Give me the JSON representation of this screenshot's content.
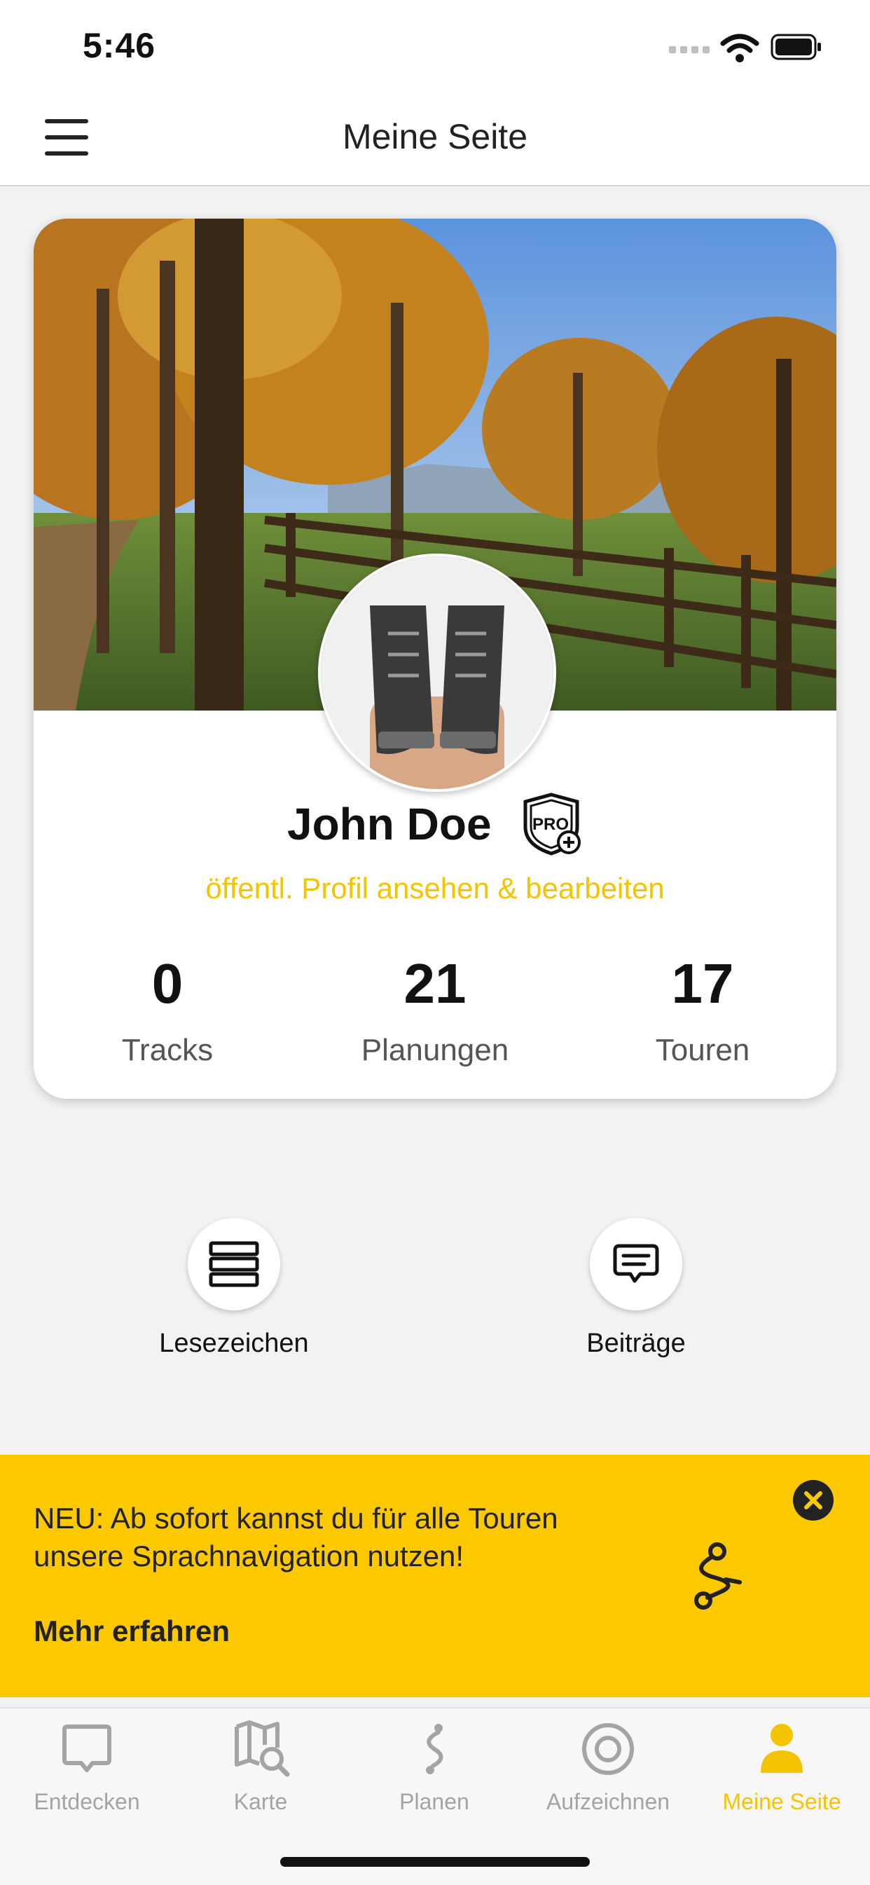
{
  "status_bar": {
    "time": "5:46"
  },
  "nav": {
    "title": "Meine Seite"
  },
  "profile": {
    "name": "John Doe",
    "link": "öffentl. Profil ansehen & bearbeiten",
    "badge_label": "PRO",
    "stats": [
      {
        "value": "0",
        "label": "Tracks"
      },
      {
        "value": "21",
        "label": "Planungen"
      },
      {
        "value": "17",
        "label": "Touren"
      }
    ]
  },
  "quick_actions": [
    {
      "label": "Lesezeichen",
      "icon": "bookmarks-icon"
    },
    {
      "label": "Beiträge",
      "icon": "posts-icon"
    }
  ],
  "banner": {
    "text": "NEU: Ab sofort kannst du für alle Touren unsere Sprachnavigation nutzen!",
    "link": "Mehr erfahren"
  },
  "tabs": [
    {
      "label": "Entdecken",
      "icon": "discover-icon",
      "active": false
    },
    {
      "label": "Karte",
      "icon": "map-icon",
      "active": false
    },
    {
      "label": "Planen",
      "icon": "plan-icon",
      "active": false
    },
    {
      "label": "Aufzeichnen",
      "icon": "record-icon",
      "active": false
    },
    {
      "label": "Meine Seite",
      "icon": "profile-icon",
      "active": true
    }
  ],
  "colors": {
    "accent": "#fcc800",
    "link": "#f5c400",
    "inactive_tab": "#a4a4a4",
    "background": "#f2f2f2"
  }
}
